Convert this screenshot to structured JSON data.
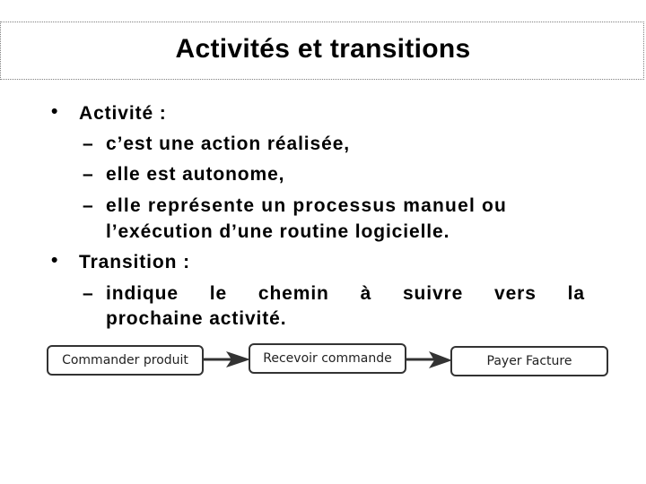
{
  "title": "Activités et transitions",
  "bullets": [
    {
      "label": "Activité :",
      "subitems": [
        "c’est une action réalisée,",
        "elle est autonome,",
        [
          "elle représente un processus manuel ou",
          "l’exécution d’une routine logicielle."
        ]
      ]
    },
    {
      "label": "Transition :",
      "subitems": [
        [
          "indique le chemin à suivre vers la",
          "prochaine activité."
        ]
      ]
    }
  ],
  "bullet_symbol": "•",
  "dash_symbol": "–",
  "justified_words": [
    "indique",
    "le",
    "chemin",
    "à",
    "suivre",
    "vers",
    "la"
  ],
  "diagram": {
    "activities": [
      "Commander produit",
      "Recevoir commande",
      "Payer Facture"
    ],
    "transitions": [
      {
        "from": "Commander produit",
        "to": "Recevoir commande"
      },
      {
        "from": "Recevoir commande",
        "to": "Payer Facture"
      }
    ],
    "stroke_color": "#333333"
  }
}
